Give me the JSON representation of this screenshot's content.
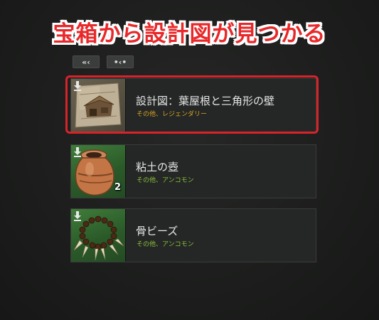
{
  "headline": "宝箱から設計図が見つかる",
  "nav": {
    "prev_label": "«‹",
    "next_label": "•‹•"
  },
  "items": [
    {
      "name": "設計図：葉屋根と三角形の壁",
      "category": "その他、レジェンダリー",
      "rarity_color": "#d6a422",
      "icon": "blueprint-house-icon",
      "quantity": ""
    },
    {
      "name": "粘土の壺",
      "category": "その他、アンコモン",
      "rarity_color": "#8bbf3c",
      "icon": "clay-pot-icon",
      "quantity": "2"
    },
    {
      "name": "骨ビーズ",
      "category": "その他、アンコモン",
      "rarity_color": "#8bbf3c",
      "icon": "bone-beads-icon",
      "quantity": ""
    }
  ],
  "colors": {
    "highlight": "#d7232a",
    "headline": "#e8282a",
    "uncommon_bg": "#3f7d3a"
  }
}
